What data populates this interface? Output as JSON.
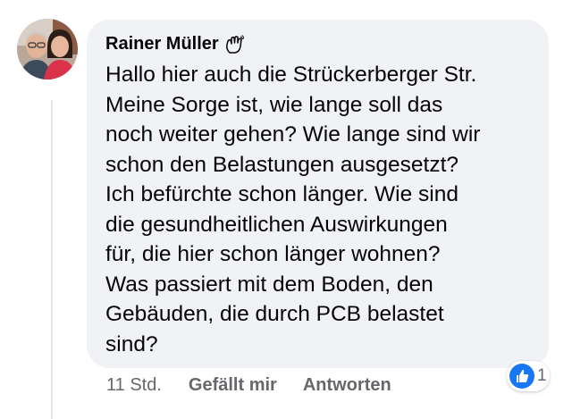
{
  "comment": {
    "author": "Rainer Müller",
    "author_badge_icon": "wave-hand-icon",
    "lines": [
      "Hallo hier auch die Strückerberger Str.",
      "Meine Sorge ist, wie lange soll das",
      "noch weiter gehen? Wie lange sind wir",
      "schon den Belastungen ausgesetzt?",
      "Ich befürchte schon länger. Wie sind",
      "die gesundheitlichen Auswirkungen",
      "für, die hier schon länger wohnen?",
      "Was passiert mit dem Boden, den",
      "Gebäuden, die durch PCB belastet",
      "sind?"
    ]
  },
  "actions": {
    "time": "11 Std.",
    "like_label": "Gefällt mir",
    "reply_label": "Antworten"
  },
  "reactions": {
    "icon": "like-icon",
    "count": "1"
  },
  "colors": {
    "bubble": "#f0f2f5",
    "text": "#050505",
    "secondary": "#65676b",
    "like_blue": "#1877f2"
  }
}
